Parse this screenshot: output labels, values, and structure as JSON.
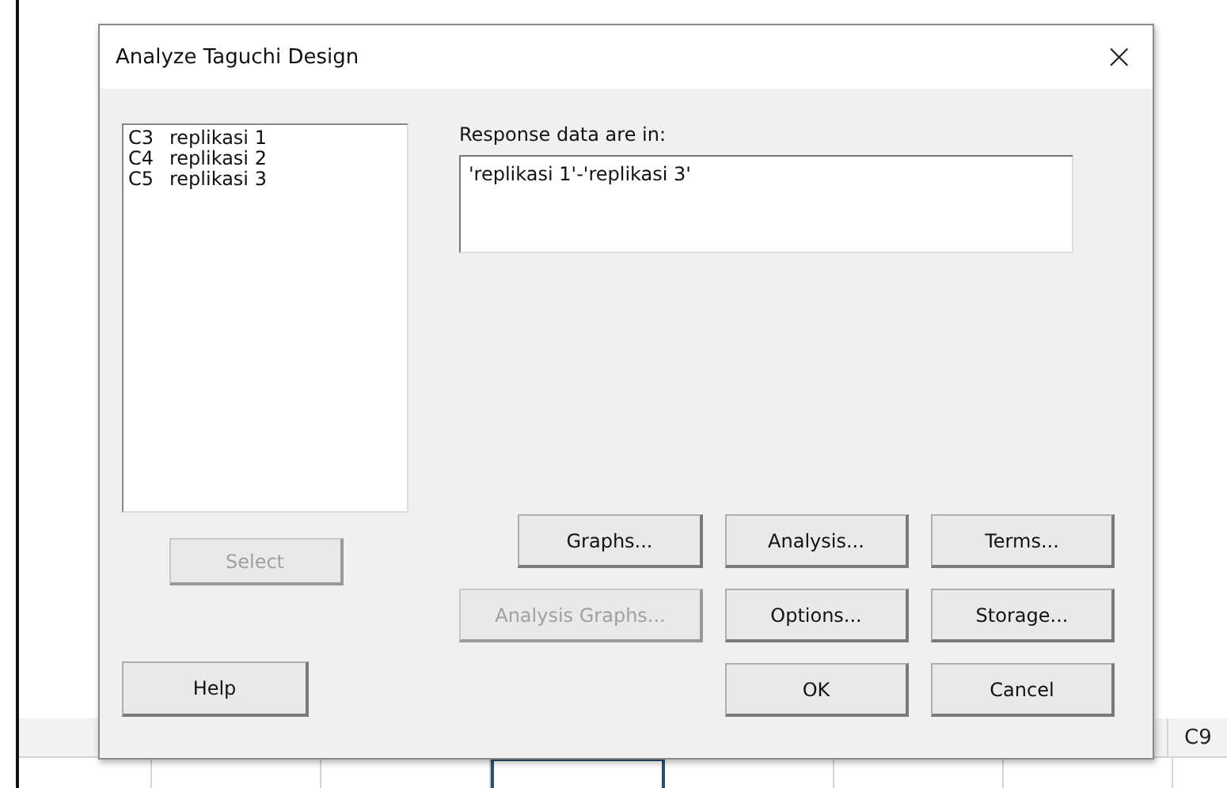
{
  "dialog": {
    "title": "Analyze Taguchi Design",
    "close": "×",
    "variables": [
      {
        "column": "C3",
        "name": "replikasi 1"
      },
      {
        "column": "C4",
        "name": "replikasi 2"
      },
      {
        "column": "C5",
        "name": "replikasi 3"
      }
    ],
    "select_button": {
      "label": "Select",
      "disabled": true
    },
    "response": {
      "label": "Response data are in:",
      "value": "'replikasi 1'-'replikasi 3'"
    },
    "option_buttons": [
      {
        "label": "Graphs...",
        "disabled": false
      },
      {
        "label": "Analysis...",
        "disabled": false
      },
      {
        "label": "Terms...",
        "disabled": false
      },
      {
        "label": "Analysis Graphs...",
        "disabled": true
      },
      {
        "label": "Options...",
        "disabled": false
      },
      {
        "label": "Storage...",
        "disabled": false
      }
    ],
    "help_button": "Help",
    "ok_button": "OK",
    "cancel_button": "Cancel"
  },
  "worksheet": {
    "column_header": "C9"
  }
}
